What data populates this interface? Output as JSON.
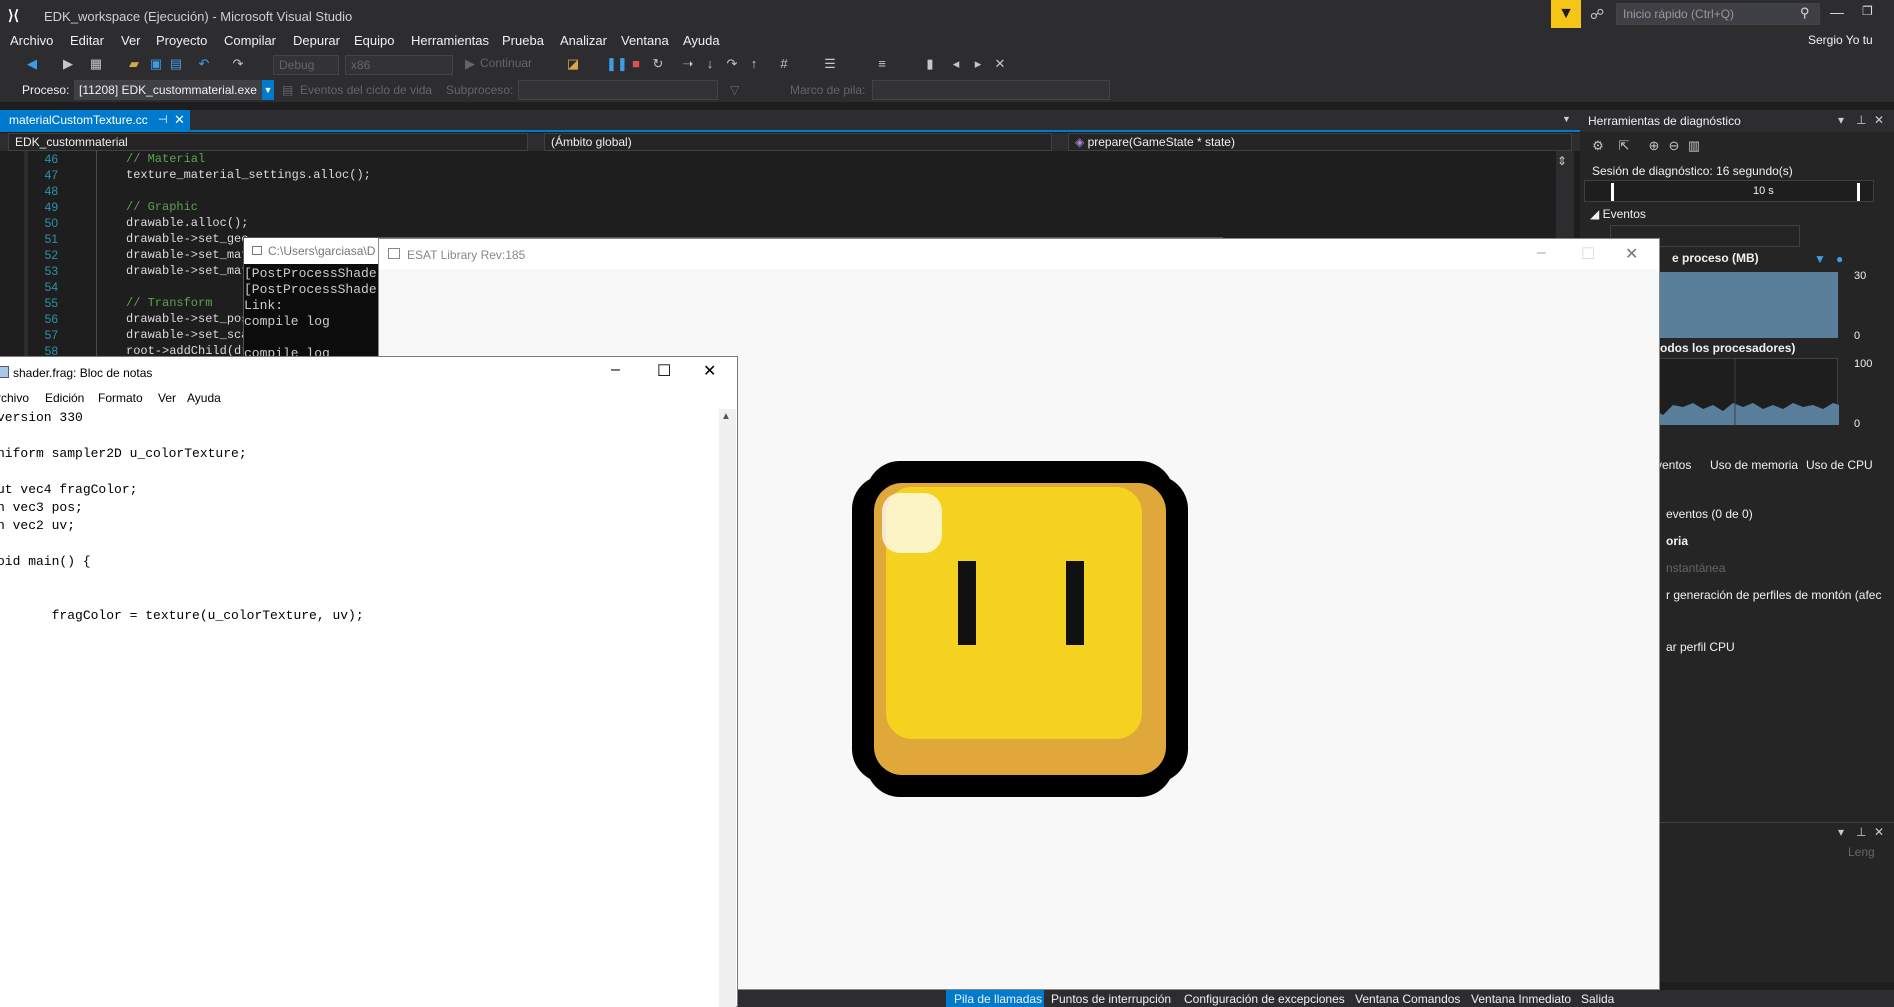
{
  "titlebar": {
    "title": "EDK_workspace (Ejecución) - Microsoft Visual Studio",
    "quick_launch_placeholder": "Inicio rápido (Ctrl+Q)",
    "user": "Sergio Yo tu"
  },
  "menu": [
    "Archivo",
    "Editar",
    "Ver",
    "Proyecto",
    "Compilar",
    "Depurar",
    "Equipo",
    "Herramientas",
    "Prueba",
    "Analizar",
    "Ventana",
    "Ayuda"
  ],
  "toolbar": {
    "config": "Debug",
    "platform": "x86",
    "continue": "Continuar"
  },
  "toolbar2": {
    "process_label": "Proceso:",
    "process_value": "[11208] EDK_custommaterial.exe",
    "lifecycle": "Eventos del ciclo de vida",
    "thread": "Subproceso:",
    "stack_frame": "Marco de pila:"
  },
  "editor": {
    "tab": "materialCustomTexture.cc",
    "nav_project": "EDK_custommaterial",
    "nav_scope": "(Ámbito global)",
    "nav_member": "prepare(GameState * state)",
    "lines": [
      {
        "n": "46",
        "code": "// Material",
        "comment": true
      },
      {
        "n": "47",
        "code": "texture_material_settings.alloc();",
        "comment": false
      },
      {
        "n": "48",
        "code": "",
        "comment": false
      },
      {
        "n": "49",
        "code": "// Graphic",
        "comment": true
      },
      {
        "n": "50",
        "code": "drawable.alloc();",
        "comment": false
      },
      {
        "n": "51",
        "code": "drawable->set_geo",
        "comment": false
      },
      {
        "n": "52",
        "code": "drawable->set_mat",
        "comment": false
      },
      {
        "n": "53",
        "code": "drawable->set_mat",
        "comment": false
      },
      {
        "n": "54",
        "code": "",
        "comment": false
      },
      {
        "n": "55",
        "code": "// Transform",
        "comment": true
      },
      {
        "n": "56",
        "code": "drawable->set_pos",
        "comment": false
      },
      {
        "n": "57",
        "code": "drawable->set_sca",
        "comment": false
      },
      {
        "n": "58",
        "code": "root->addChild(dr",
        "comment": false
      }
    ]
  },
  "console": {
    "title": "C:\\Users\\garciasa\\D",
    "lines": [
      "[PostProcessShade",
      "[PostProcessShade",
      "Link:",
      "compile log",
      "compile log"
    ]
  },
  "diagnostics": {
    "title": "Herramientas de diagnóstico",
    "session": "Sesión de diagnóstico: 16 segundo(s)",
    "timeline_mark": "10 s",
    "events": "Eventos",
    "mem_label": "e proceso (MB)",
    "mem_max": "30",
    "mem_min": "0",
    "cpu_label": "todos los procesadores)",
    "cpu_max": "100",
    "cpu_min": "0",
    "tabs": [
      "ventos",
      "Uso de memoria",
      "Uso de CPU"
    ],
    "events_count": "eventos (0 de 0)",
    "memory_section": "oria",
    "snapshot": "nstantánea",
    "heap_profiling": "r generación de perfiles de montón (afec",
    "cpu_profile": "ar perfil CPU",
    "lower_col": "Leng"
  },
  "esat": {
    "title": "ESAT Library Rev:185"
  },
  "notepad": {
    "title": "shader.frag: Bloc de notas",
    "menu": [
      "rchivo",
      "Edición",
      "Formato",
      "Ver",
      "Ayuda"
    ],
    "lines": [
      "version 330",
      "",
      "niform sampler2D u_colorTexture;",
      "",
      "ut vec4 fragColor;",
      "n vec3 pos;",
      "n vec2 uv;",
      "",
      "oid main() {",
      "",
      "",
      "       fragColor = texture(u_colorTexture, uv);",
      ""
    ]
  },
  "statusbar": [
    "Pila de llamadas",
    "Puntos de interrupción",
    "Configuración de excepciones",
    "Ventana Comandos",
    "Ventana Inmediato",
    "Salida"
  ],
  "colors": {
    "accent": "#007acc",
    "filter": "#f5c518",
    "coin_yellow": "#f5d21f",
    "coin_shadow": "#e0a83a"
  }
}
